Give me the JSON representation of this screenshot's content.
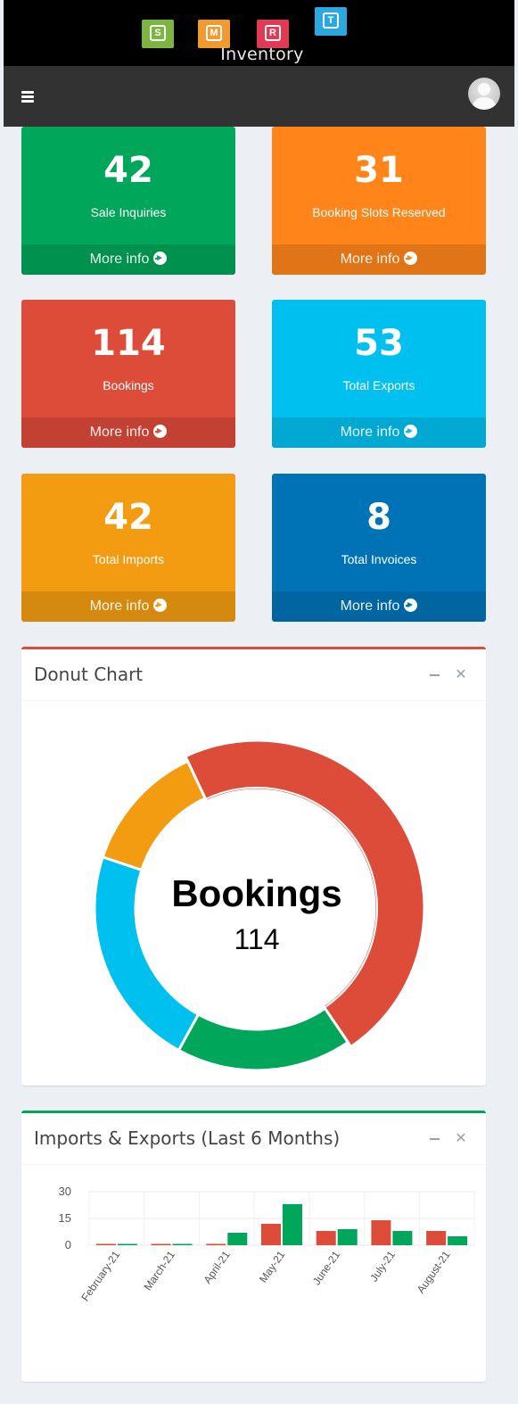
{
  "brand": {
    "name": "Inventory",
    "logo_letters": [
      "S",
      "M",
      "R",
      "T"
    ],
    "logo_colors": [
      "#7cb540",
      "#f09a2f",
      "#e03a54",
      "#2aa9e0"
    ]
  },
  "navbar": {
    "menu_icon": "hamburger-icon",
    "avatar_icon": "user-avatar-icon"
  },
  "tiles": [
    {
      "value": "42",
      "label": "Sale Inquiries",
      "more": "More info",
      "color": "#00a65a"
    },
    {
      "value": "31",
      "label": "Booking Slots Reserved",
      "more": "More info",
      "color": "#ff851b"
    },
    {
      "value": "114",
      "label": "Bookings",
      "more": "More info",
      "color": "#dd4b39"
    },
    {
      "value": "53",
      "label": "Total Exports",
      "more": "More info",
      "color": "#00c0ef"
    },
    {
      "value": "42",
      "label": "Total Imports",
      "more": "More info",
      "color": "#f39c12"
    },
    {
      "value": "8",
      "label": "Total Invoices",
      "more": "More info",
      "color": "#0073b7"
    }
  ],
  "donut": {
    "title": "Donut Chart",
    "tools": [
      "minus-icon",
      "close-icon"
    ],
    "accent": "#dd4b39",
    "center_label": "Bookings",
    "center_value": "114"
  },
  "bar_panel": {
    "title": "Imports & Exports (Last 6 Months)",
    "tools": [
      "minus-icon",
      "close-icon"
    ],
    "accent": "#00a65a"
  },
  "chart_data": [
    {
      "type": "pie",
      "variant": "donut",
      "slices": [
        {
          "name": "Bookings",
          "value": 114,
          "color": "#dd4b39"
        },
        {
          "name": "Sale Inquiries",
          "value": 42,
          "color": "#00a65a"
        },
        {
          "name": "Total Exports",
          "value": 53,
          "color": "#00c0ef"
        },
        {
          "name": "Booking Slots Reserved",
          "value": 31,
          "color": "#f39c12"
        }
      ],
      "highlighted": "Bookings"
    },
    {
      "type": "bar",
      "categories": [
        "February-21",
        "March-21",
        "April-21",
        "May-21",
        "June-21",
        "July-21",
        "August-21"
      ],
      "series": [
        {
          "values": [
            0,
            0,
            0,
            12,
            8,
            14,
            8
          ],
          "color": "#dd4b39"
        },
        {
          "values": [
            0,
            0,
            7,
            23,
            9,
            8,
            5
          ],
          "color": "#00a65a"
        }
      ],
      "ylim": [
        0,
        30
      ],
      "yticks": [
        0,
        15,
        30
      ],
      "grid": true
    }
  ]
}
